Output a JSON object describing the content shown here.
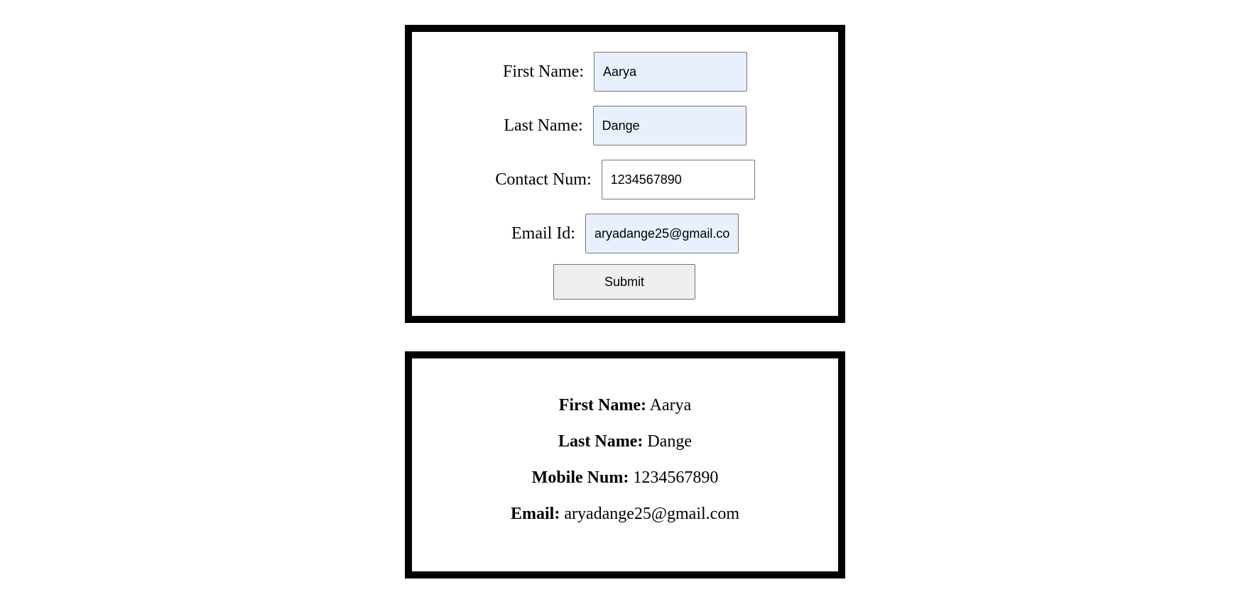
{
  "form": {
    "fields": [
      {
        "label": "First Name:",
        "value": "Aarya"
      },
      {
        "label": "Last Name:",
        "value": "Dange"
      },
      {
        "label": "Contact Num:",
        "value": "1234567890"
      },
      {
        "label": "Email Id:",
        "value": "aryadange25@gmail.com"
      }
    ],
    "submit_label": "Submit",
    "autofill_color": "#e8f0fe"
  },
  "result": {
    "lines": [
      {
        "label": "First Name:",
        "value": "Aarya"
      },
      {
        "label": "Last Name:",
        "value": "Dange"
      },
      {
        "label": "Mobile Num:",
        "value": "1234567890"
      },
      {
        "label": "Email:",
        "value": "aryadange25@gmail.com"
      }
    ]
  }
}
